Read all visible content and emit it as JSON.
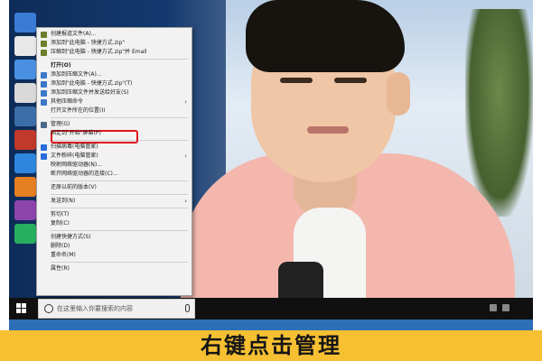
{
  "context_menu": {
    "items": [
      {
        "label": "创建报道文件(A)...",
        "icon_color": "#6b7f2a",
        "arrow": false,
        "bold": false
      },
      {
        "label": "添加到\"此电脑 - 快捷方式.zip\"",
        "icon_color": "#6b7f2a",
        "arrow": false,
        "bold": false
      },
      {
        "label": "压缩到\"此电脑 - 快捷方式.zip\"并 Email",
        "icon_color": "#6b7f2a",
        "arrow": false,
        "bold": false
      },
      {
        "label": "打开(O)",
        "icon_color": "",
        "arrow": false,
        "bold": true
      },
      {
        "label": "添加到压缩文件(A)...",
        "icon_color": "#3a78c8",
        "arrow": false,
        "bold": false
      },
      {
        "label": "添加到\"此电脑 - 快捷方式.zip\"(T)",
        "icon_color": "#3a78c8",
        "arrow": false,
        "bold": false
      },
      {
        "label": "添加到压缩文件并发送给好友(S)",
        "icon_color": "#3a78c8",
        "arrow": false,
        "bold": false
      },
      {
        "label": "其他压缩命令",
        "icon_color": "#3a78c8",
        "arrow": true,
        "bold": false
      },
      {
        "label": "打开文件所在的位置(I)",
        "icon_color": "",
        "arrow": false,
        "bold": false
      },
      {
        "label": "管理(G)",
        "icon_color": "#4a6a8a",
        "arrow": false,
        "bold": false,
        "highlighted": true
      },
      {
        "label": "固定到\"开始\"屏幕(P)",
        "icon_color": "",
        "arrow": false,
        "bold": false
      },
      {
        "label": "扫描病毒(电脑管家)",
        "icon_color": "#2a6dd8",
        "arrow": false,
        "bold": false
      },
      {
        "label": "文件粉碎(电脑管家)",
        "icon_color": "#2a6dd8",
        "arrow": true,
        "bold": false
      },
      {
        "label": "映射网络驱动器(N)...",
        "icon_color": "",
        "arrow": false,
        "bold": false
      },
      {
        "label": "断开网络驱动器的连接(C)...",
        "icon_color": "",
        "arrow": false,
        "bold": false
      },
      {
        "label": "还原以前的版本(V)",
        "icon_color": "",
        "arrow": false,
        "bold": false
      },
      {
        "label": "发送到(N)",
        "icon_color": "",
        "arrow": true,
        "bold": false
      },
      {
        "label": "剪切(T)",
        "icon_color": "",
        "arrow": false,
        "bold": false
      },
      {
        "label": "复制(C)",
        "icon_color": "",
        "arrow": false,
        "bold": false
      },
      {
        "label": "创建快捷方式(S)",
        "icon_color": "",
        "arrow": false,
        "bold": false
      },
      {
        "label": "删除(D)",
        "icon_color": "",
        "arrow": false,
        "bold": false
      },
      {
        "label": "重命名(M)",
        "icon_color": "",
        "arrow": false,
        "bold": false
      },
      {
        "label": "属性(R)",
        "icon_color": "",
        "arrow": false,
        "bold": false
      }
    ]
  },
  "taskbar": {
    "search_placeholder": "在这里输入你要搜索的内容"
  },
  "caption": {
    "text": "右键点击管理"
  },
  "colors": {
    "highlight_box": "#e0161d",
    "caption_bar": "#f7c033",
    "taskbar": "#101010"
  }
}
